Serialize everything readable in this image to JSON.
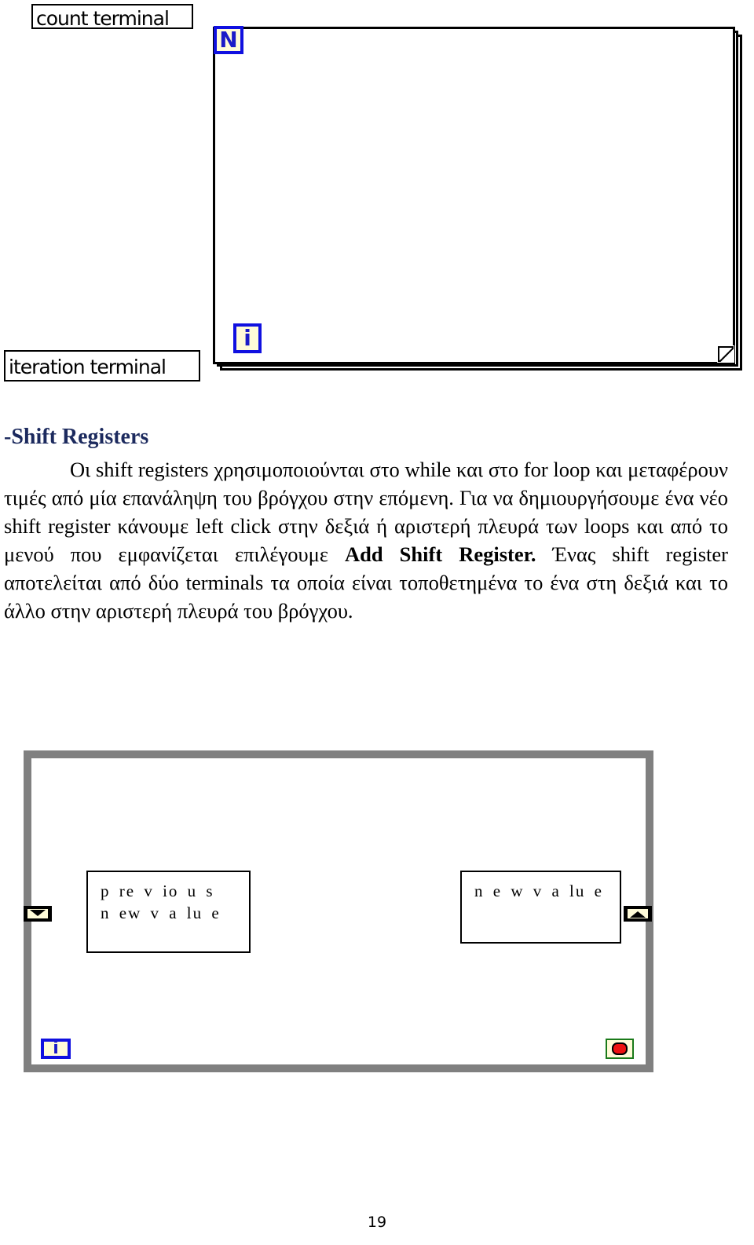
{
  "figure1": {
    "count_terminal_label": "count terminal",
    "iteration_terminal_label": "iteration terminal",
    "count_terminal_glyph": "N",
    "iteration_terminal_glyph": "i"
  },
  "section": {
    "heading": "-Shift Registers",
    "paragraph_part1": "Οι shift registers χρησιμοποιούνται στο while και στο for loop και μεταφέρουν τιμές από μία επανάληψη του βρόγχου στην επόμενη. Για να δημιουργήσουμε ένα νέο shift register κάνουμε left click στην δεξιά ή αριστερή πλευρά των loops και από το μενού που εμφανίζεται επιλέγουμε ",
    "paragraph_bold": "Add Shift Register.",
    "paragraph_part2": " Ένας shift register αποτελείται από δύο terminals τα οποία είναι τοποθετημένα το ένα στη δεξιά και το άλλο στην αριστερή πλευρά του βρόγχου."
  },
  "figure2": {
    "previous_box_line1": "p re v io u s",
    "previous_box_line2": "n ew v a lu e",
    "new_box_text": "n e w v a lu e",
    "iteration_terminal_glyph": "i"
  },
  "colors": {
    "terminal_border": "#1010e0",
    "terminal_fill": "#fffbd8",
    "while_loop_border": "#808080",
    "stop_red": "#ee1111",
    "heading_color": "#1c2a5e"
  },
  "page_number": "19"
}
